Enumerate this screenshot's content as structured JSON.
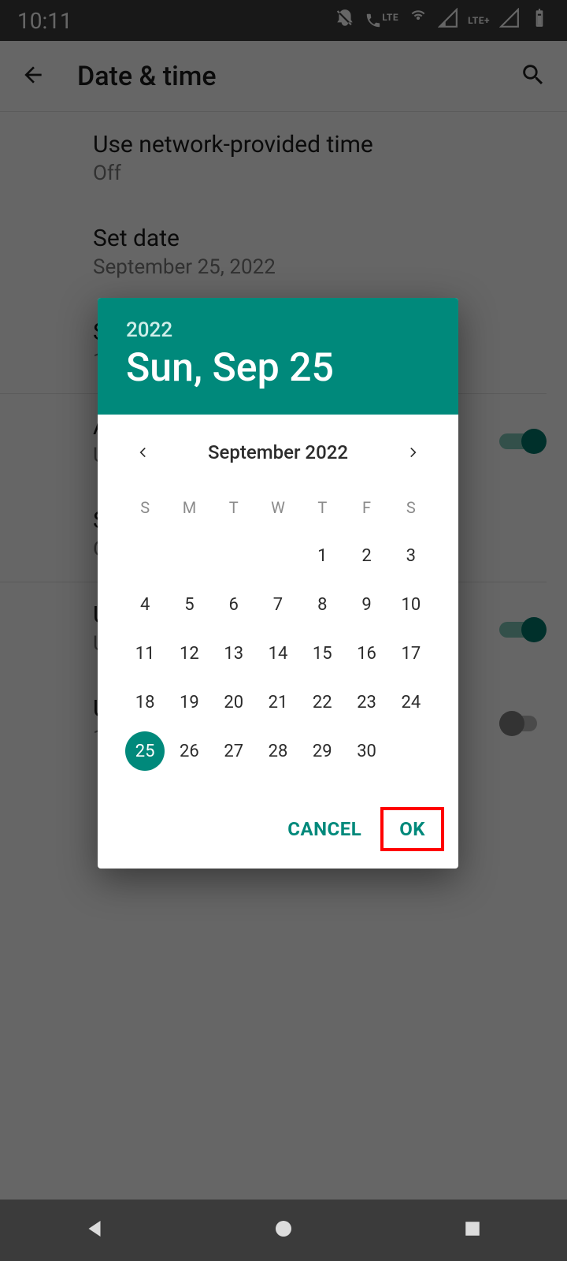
{
  "status": {
    "time": "10:11",
    "lte_label": "LTE"
  },
  "appbar": {
    "title": "Date & time"
  },
  "settings": {
    "network_time": {
      "label": "Use network-provided time",
      "value": "Off"
    },
    "set_date": {
      "label": "Set date",
      "value": "September 25, 2022"
    },
    "set_time": {
      "label": "S",
      "value": "1"
    },
    "auto_tz": {
      "label": "A",
      "value": "U"
    },
    "set_tz": {
      "label": "S",
      "value": "G"
    },
    "use_locale": {
      "label": "U",
      "value": "U"
    },
    "use_24h": {
      "label": "U",
      "value": "1"
    }
  },
  "picker": {
    "year": "2022",
    "header_date": "Sun, Sep 25",
    "month_label": "September 2022",
    "dow": [
      "S",
      "M",
      "T",
      "W",
      "T",
      "F",
      "S"
    ],
    "weeks": [
      [
        "",
        "",
        "",
        "",
        "1",
        "2",
        "3"
      ],
      [
        "4",
        "5",
        "6",
        "7",
        "8",
        "9",
        "10"
      ],
      [
        "11",
        "12",
        "13",
        "14",
        "15",
        "16",
        "17"
      ],
      [
        "18",
        "19",
        "20",
        "21",
        "22",
        "23",
        "24"
      ],
      [
        "25",
        "26",
        "27",
        "28",
        "29",
        "30",
        ""
      ]
    ],
    "selected_day": "25",
    "cancel_label": "CANCEL",
    "ok_label": "OK"
  }
}
